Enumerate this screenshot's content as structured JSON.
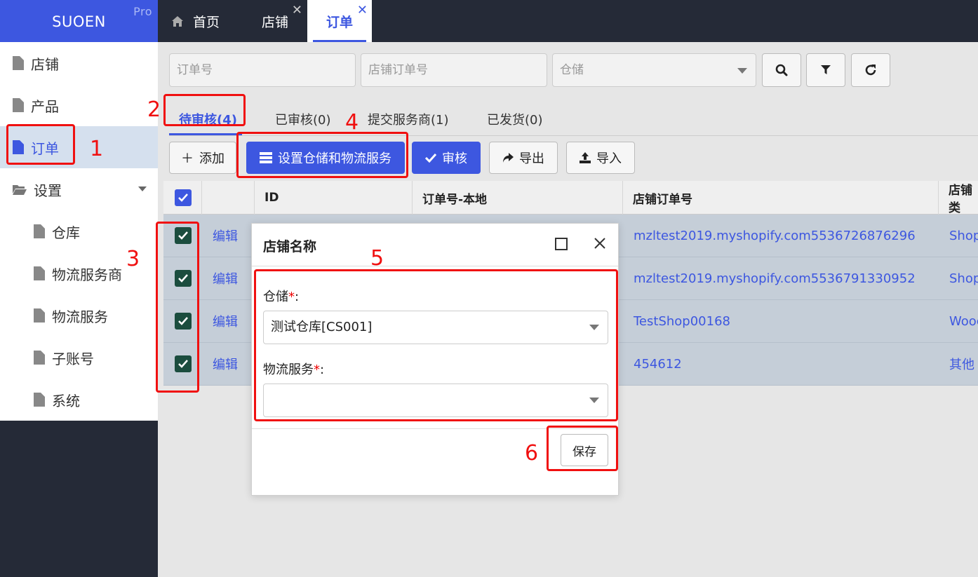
{
  "brand": {
    "name": "SUOEN",
    "badge": "Pro"
  },
  "sidebar": {
    "items": [
      {
        "label": "店铺",
        "icon": "file-icon"
      },
      {
        "label": "产品",
        "icon": "file-icon"
      },
      {
        "label": "订单",
        "icon": "file-icon",
        "active": true
      },
      {
        "label": "设置",
        "icon": "folder-open-icon",
        "expanded": true
      },
      {
        "label": "仓库",
        "icon": "file-icon"
      },
      {
        "label": "物流服务商",
        "icon": "file-icon"
      },
      {
        "label": "物流服务",
        "icon": "file-icon"
      },
      {
        "label": "子账号",
        "icon": "file-icon"
      },
      {
        "label": "系统",
        "icon": "file-icon"
      }
    ]
  },
  "tabs": [
    {
      "label": "首页",
      "icon": "home-icon"
    },
    {
      "label": "店铺",
      "closable": true
    },
    {
      "label": "订单",
      "closable": true,
      "active": true
    }
  ],
  "search": {
    "order_no_placeholder": "订单号",
    "shop_order_no_placeholder": "店铺订单号",
    "warehouse_placeholder": "仓储"
  },
  "filter_tabs": [
    {
      "label": "待审核(4)",
      "active": true
    },
    {
      "label": "已审核(0)"
    },
    {
      "label": "提交服务商(1)"
    },
    {
      "label": "已发货(0)"
    }
  ],
  "actions": {
    "add": "添加",
    "set_warehouse": "设置仓储和物流服务",
    "review": "审核",
    "export": "导出",
    "import": "导入"
  },
  "table": {
    "columns": [
      "ID",
      "订单号-本地",
      "店铺订单号",
      "店铺类"
    ],
    "rows": [
      {
        "edit": "编辑",
        "shop_order_no": "mzltest2019.myshopify.com5536726876296",
        "shop_type": "Shop"
      },
      {
        "edit": "编辑",
        "shop_order_no": "mzltest2019.myshopify.com5536791330952",
        "shop_type": "Shop"
      },
      {
        "edit": "编辑",
        "shop_order_no": "TestShop00168",
        "shop_type": "Wooc"
      },
      {
        "edit": "编辑",
        "shop_order_no": "454612",
        "shop_type": "其他"
      }
    ]
  },
  "dialog": {
    "title": "店铺名称",
    "warehouse_label": "仓储",
    "warehouse_value": "测试仓库[CS001]",
    "logistics_label": "物流服务",
    "logistics_value": "",
    "required_mark": "*",
    "colon": ":",
    "save": "保存"
  },
  "annotations": [
    "1",
    "2",
    "3",
    "4",
    "5",
    "6"
  ],
  "colors": {
    "accent": "#3d57e0",
    "dark": "#252a37",
    "annotation": "#f01010",
    "checkbox": "#1b4d3e"
  }
}
